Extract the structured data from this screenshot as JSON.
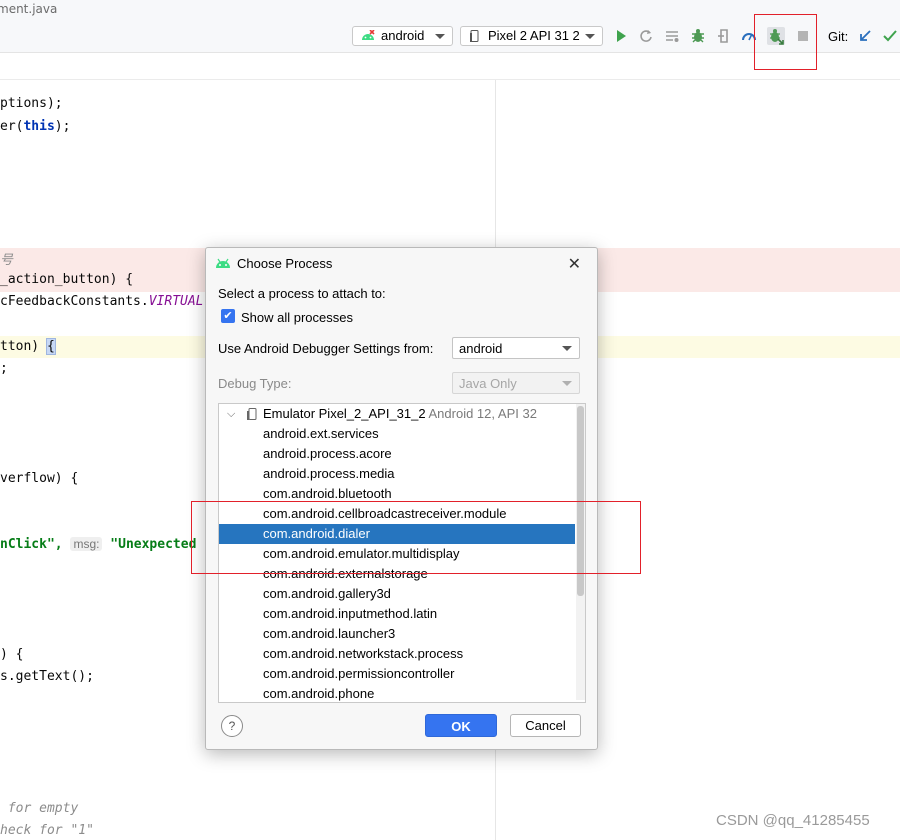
{
  "tab": {
    "label": "ment.java"
  },
  "toolbar": {
    "run_config": "android",
    "device": "Pixel 2 API 31 2",
    "git_label": "Git:"
  },
  "editor": {
    "lines": [
      {
        "p1": "ptions);"
      },
      {
        "p1": "er(",
        "kw": "this",
        "p2": ");"
      },
      {
        "cmt": "号"
      },
      {
        "p1": "_action_button) {"
      },
      {
        "p1": "cFeedbackConstants.",
        "ital": "VIRTUAL"
      },
      {
        "p1": "tton) ",
        "brace": "{"
      },
      {
        "p1": ";"
      },
      {
        "p1": "verflow) {"
      },
      {
        "p1": "nClick\", ",
        "hint": "msg:",
        "str": "\"Unexpected"
      },
      {
        "p1": ") {"
      },
      {
        "p1": "s.getText();"
      },
      {
        "cmt": " for empty"
      },
      {
        "cmt": "heck for \"1\""
      }
    ]
  },
  "dialog": {
    "title": "Choose Process",
    "prompt": "Select a process to attach to:",
    "show_all": "Show all processes",
    "debugger_label": "Use Android Debugger Settings from:",
    "debugger_value": "android",
    "debug_type_label": "Debug Type:",
    "debug_type_value": "Java Only",
    "device": {
      "name": "Emulator Pixel_2_API_31_2",
      "detail": "Android 12, API 32"
    },
    "processes": [
      "android.ext.services",
      "android.process.acore",
      "android.process.media",
      "com.android.bluetooth",
      "com.android.cellbroadcastreceiver.module",
      "com.android.dialer",
      "com.android.emulator.multidisplay",
      "com.android.externalstorage",
      "com.android.gallery3d",
      "com.android.inputmethod.latin",
      "com.android.launcher3",
      "com.android.networkstack.process",
      "com.android.permissioncontroller",
      "com.android.phone"
    ],
    "selected_process": "com.android.dialer",
    "help": "?",
    "ok": "OK",
    "cancel": "Cancel"
  },
  "watermark": "CSDN @qq_41285455",
  "colors": {
    "accent": "#3574f0",
    "selection": "#2675bf",
    "annotation_red": "#e2202a",
    "android_green": "#3ddc84"
  },
  "icons": [
    "android-icon",
    "device-icon",
    "run-icon",
    "rerun-icon",
    "coverage-icon",
    "debug-icon",
    "profile-icon",
    "attach-debugger-icon",
    "stop-icon",
    "git-update-icon",
    "git-commit-icon",
    "close-icon",
    "chevron-down-icon",
    "checkmark-icon",
    "help-icon"
  ]
}
